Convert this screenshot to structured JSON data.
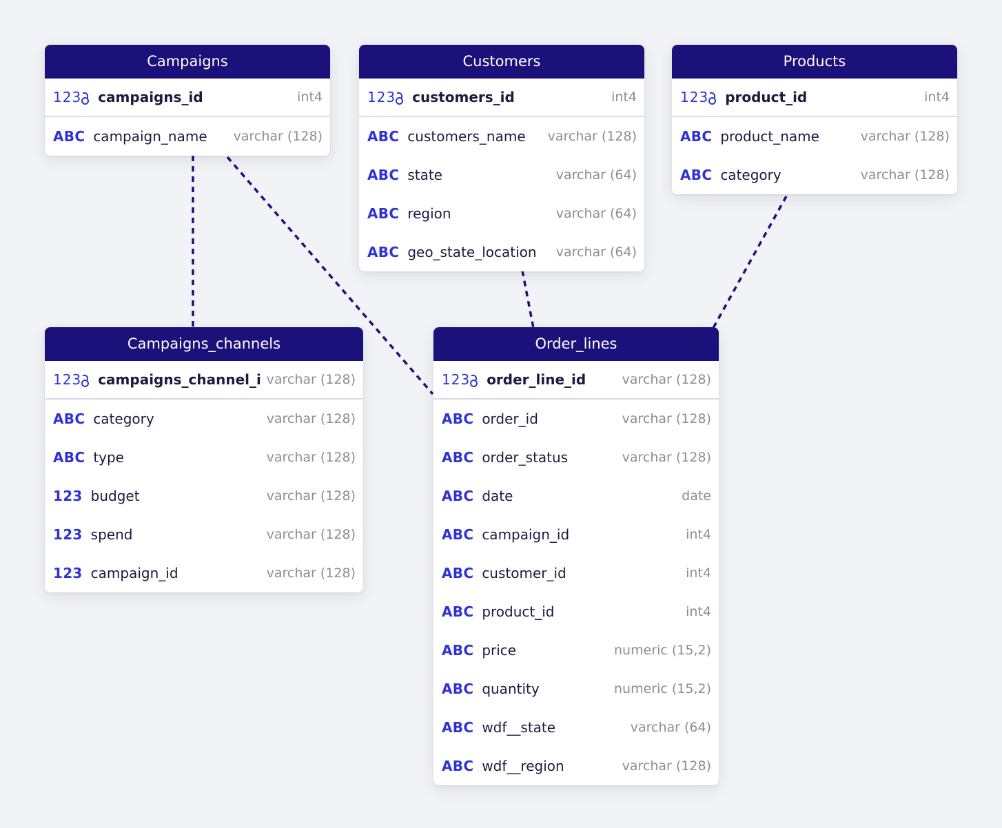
{
  "tables": {
    "campaigns": {
      "title": "Campaigns",
      "columns": [
        {
          "icon": "123",
          "name": "campaigns_id",
          "type": "int4"
        },
        {
          "icon": "ABC",
          "name": "campaign_name",
          "type": "varchar (128)"
        }
      ]
    },
    "customers": {
      "title": "Customers",
      "columns": [
        {
          "icon": "123",
          "name": "customers_id",
          "type": "int4"
        },
        {
          "icon": "ABC",
          "name": "customers_name",
          "type": "varchar (128)"
        },
        {
          "icon": "ABC",
          "name": "state",
          "type": "varchar (64)"
        },
        {
          "icon": "ABC",
          "name": "region",
          "type": "varchar (64)"
        },
        {
          "icon": "ABC",
          "name": "geo_state_location",
          "type": "varchar (64)"
        }
      ]
    },
    "products": {
      "title": "Products",
      "columns": [
        {
          "icon": "123",
          "name": "product_id",
          "type": "int4"
        },
        {
          "icon": "ABC",
          "name": "product_name",
          "type": "varchar (128)"
        },
        {
          "icon": "ABC",
          "name": "category",
          "type": "varchar (128)"
        }
      ]
    },
    "campaigns_channels": {
      "title": "Campaigns_channels",
      "columns": [
        {
          "icon": "123",
          "name": "campaigns_channel_id",
          "type": "varchar (128)"
        },
        {
          "icon": "ABC",
          "name": "category",
          "type": "varchar (128)"
        },
        {
          "icon": "ABC",
          "name": "type",
          "type": "varchar (128)"
        },
        {
          "icon": "123",
          "name": "budget",
          "type": "varchar (128)"
        },
        {
          "icon": "123",
          "name": "spend",
          "type": "varchar (128)"
        },
        {
          "icon": "123",
          "name": "campaign_id",
          "type": "varchar (128)"
        }
      ]
    },
    "order_lines": {
      "title": "Order_lines",
      "columns": [
        {
          "icon": "123",
          "name": "order_line_id",
          "type": "varchar (128)"
        },
        {
          "icon": "ABC",
          "name": "order_id",
          "type": "varchar (128)"
        },
        {
          "icon": "ABC",
          "name": "order_status",
          "type": "varchar (128)"
        },
        {
          "icon": "ABC",
          "name": "date",
          "type": "date"
        },
        {
          "icon": "ABC",
          "name": "campaign_id",
          "type": "int4"
        },
        {
          "icon": "ABC",
          "name": "customer_id",
          "type": "int4"
        },
        {
          "icon": "ABC",
          "name": "product_id",
          "type": "int4"
        },
        {
          "icon": "ABC",
          "name": "price",
          "type": "numeric (15,2)"
        },
        {
          "icon": "ABC",
          "name": "quantity",
          "type": "numeric (15,2)"
        },
        {
          "icon": "ABC",
          "name": "wdf__state",
          "type": "varchar (64)"
        },
        {
          "icon": "ABC",
          "name": "wdf__region",
          "type": "varchar (128)"
        }
      ]
    }
  },
  "relationships": [
    {
      "from": "Campaigns",
      "to": "Campaigns_channels"
    },
    {
      "from": "Campaigns",
      "to": "Order_lines"
    },
    {
      "from": "Customers",
      "to": "Order_lines"
    },
    {
      "from": "Products",
      "to": "Order_lines"
    }
  ],
  "colors": {
    "header_background": "#1b117a",
    "type_icon": "#2f33d4",
    "connector": "#1b117a",
    "canvas": "#f2f3f6"
  }
}
